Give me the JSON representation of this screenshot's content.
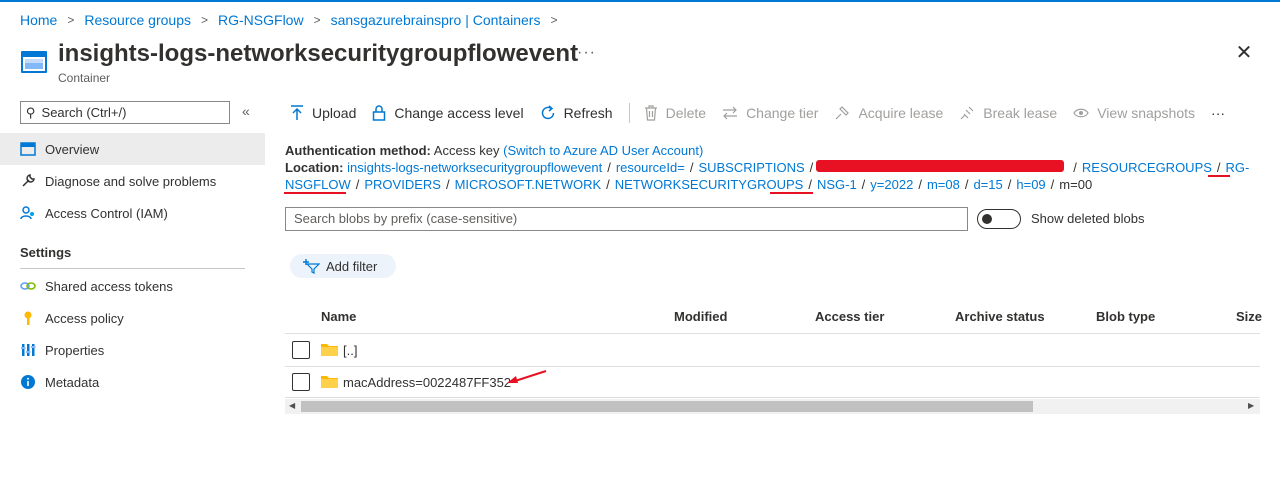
{
  "breadcrumb": {
    "items": [
      "Home",
      "Resource groups",
      "RG-NSGFlow",
      "sansgazurebrainspro | Containers"
    ],
    "separator": ">"
  },
  "header": {
    "title": "insights-logs-networksecuritygroupflowevent",
    "subtitle": "Container",
    "more": "···",
    "close": "✕"
  },
  "sidebar": {
    "search_placeholder": "Search (Ctrl+/)",
    "collapse": "«",
    "items": [
      {
        "label": "Overview",
        "icon": "overview-icon"
      },
      {
        "label": "Diagnose and solve problems",
        "icon": "wrench-icon"
      },
      {
        "label": "Access Control (IAM)",
        "icon": "people-icon"
      }
    ],
    "settings_heading": "Settings",
    "settings_items": [
      {
        "label": "Shared access tokens",
        "icon": "link-icon"
      },
      {
        "label": "Access policy",
        "icon": "key-icon"
      },
      {
        "label": "Properties",
        "icon": "properties-icon"
      },
      {
        "label": "Metadata",
        "icon": "info-icon"
      }
    ]
  },
  "toolbar": {
    "upload": "Upload",
    "change_access_level": "Change access level",
    "refresh": "Refresh",
    "delete": "Delete",
    "change_tier": "Change tier",
    "acquire_lease": "Acquire lease",
    "break_lease": "Break lease",
    "view_snapshots": "View snapshots",
    "more": "···"
  },
  "info": {
    "auth_label": "Authentication method:",
    "auth_value": "Access key",
    "auth_switch": "(Switch to Azure AD User Account)",
    "location_label": "Location:",
    "location_segments": {
      "container": "insights-logs-networksecuritygroupflowevent",
      "resourceid": "resourceId=",
      "subscriptions": "SUBSCRIPTIONS",
      "resourcegroups": "RESOURCEGROUPS",
      "rg_part1": "RG-",
      "rg_part2": "NSGFLOW",
      "providers": "PROVIDERS",
      "microsoft_network": "MICROSOFT.NETWORK",
      "nsgs": "NETWORKSECURITYGROUPS",
      "nsg": "NSG-1",
      "y": "y=2022",
      "m": "m=08",
      "d": "d=15",
      "h": "h=09",
      "min": "m=00"
    },
    "slash": "/"
  },
  "blob_search": {
    "placeholder": "Search blobs by prefix (case-sensitive)"
  },
  "show_deleted": {
    "label": "Show deleted blobs",
    "on": false
  },
  "filter": {
    "label": "Add filter"
  },
  "table": {
    "columns": [
      "Name",
      "Modified",
      "Access tier",
      "Archive status",
      "Blob type",
      "Size"
    ],
    "rows": [
      {
        "name": "[..]"
      },
      {
        "name": "macAddress=0022487FF352"
      }
    ]
  },
  "colors": {
    "accent": "#0078d4",
    "annotation": "#e81123",
    "folder": "#ffb900"
  }
}
